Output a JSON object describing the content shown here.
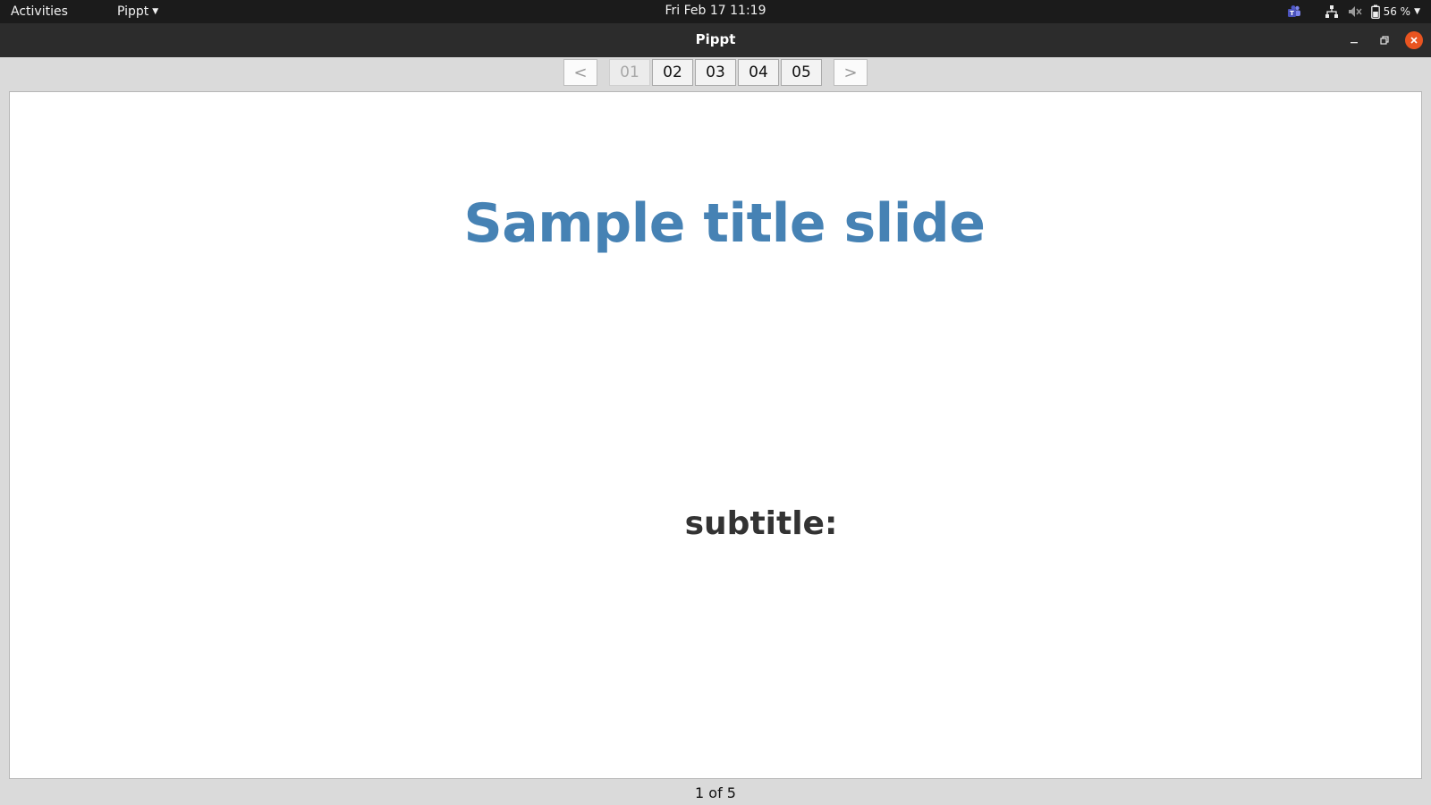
{
  "topbar": {
    "activities_label": "Activities",
    "app_menu_label": "Pippt",
    "clock": "Fri Feb 17  11:19",
    "battery_percent": "56 %",
    "icons": [
      "teams-icon",
      "network-icon",
      "volume-muted-icon",
      "battery-icon",
      "chevron-down-icon"
    ]
  },
  "window": {
    "title": "Pippt"
  },
  "navigation": {
    "prev_label": "<",
    "next_label": ">",
    "pages": [
      "01",
      "02",
      "03",
      "04",
      "05"
    ],
    "current_page": "01"
  },
  "slide": {
    "title": "Sample title slide",
    "subtitle": "subtitle:"
  },
  "status": {
    "page_indicator": "1 of 5"
  },
  "colors": {
    "title_blue": "#4682b4",
    "close_orange": "#e95420"
  }
}
